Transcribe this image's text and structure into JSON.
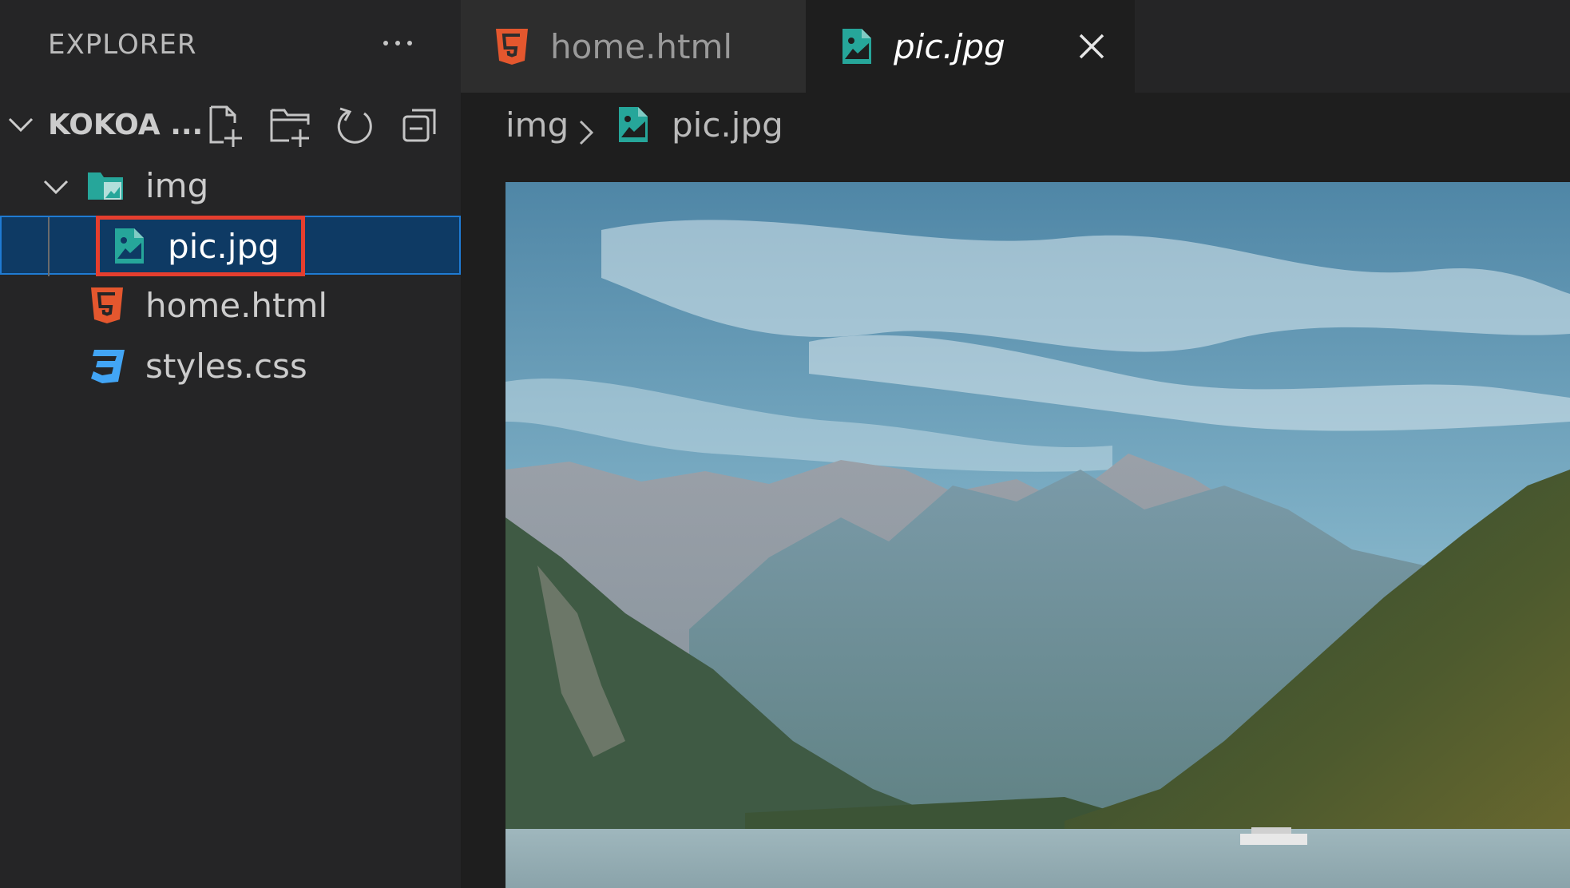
{
  "sidebar": {
    "title": "EXPLORER",
    "root_label": "KOKOA ...",
    "tree": {
      "folder": "img",
      "selected_file": "pic.jpg",
      "file_html": "home.html",
      "file_css": "styles.css"
    }
  },
  "tabs": [
    {
      "label": "home.html",
      "icon": "html5-icon"
    },
    {
      "label": "pic.jpg",
      "icon": "image-file-icon",
      "active": true
    }
  ],
  "breadcrumb": {
    "folder": "img",
    "file": "pic.jpg"
  },
  "colors": {
    "accent_selection": "#0e3a64",
    "highlight_box": "#e53e2e",
    "html_icon": "#e4572e",
    "css_icon": "#42a5f5",
    "image_icon": "#26a69a"
  }
}
